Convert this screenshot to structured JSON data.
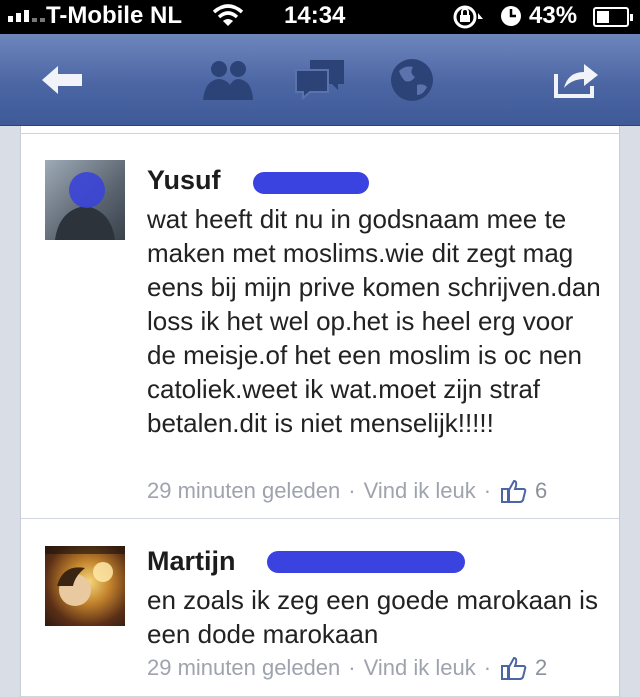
{
  "status_bar": {
    "carrier": "T-Mobile NL",
    "time": "14:34",
    "battery": "43%",
    "battery_level": 0.43
  },
  "nav": {
    "icons": [
      "back-arrow-icon",
      "friends-icon",
      "messages-icon",
      "globe-icon",
      "share-icon"
    ],
    "color": "#4c66a4"
  },
  "comments": [
    {
      "author": "Yusuf",
      "text": "wat heeft dit nu in godsnaam mee te maken met moslims.wie dit zegt mag eens bij mijn prive komen schrijven.dan loss ik het wel op.het is heel erg voor de meisje.of het een moslim is oc nen catoliek.weet ik wat.moet zijn straf betalen.dit is niet menselijk!!!!!",
      "time": "29 minuten geleden",
      "separator": "·",
      "like_label": "Vind ik leuk",
      "like_count": "6"
    },
    {
      "author": "Martijn",
      "text": "en zoals ik zeg een goede marokaan is een dode marokaan",
      "time": "29 minuten geleden",
      "separator": "·",
      "like_label": "Vind ik leuk",
      "like_count": "2"
    }
  ]
}
